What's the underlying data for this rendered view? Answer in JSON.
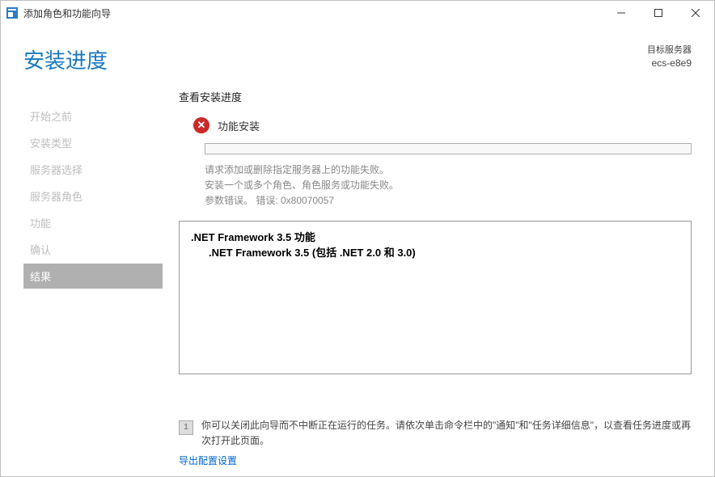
{
  "window": {
    "title": "添加角色和功能向导"
  },
  "header": {
    "title": "安装进度",
    "target_label": "目标服务器",
    "target_name": "ecs-e8e9"
  },
  "sidebar": {
    "steps": [
      {
        "label": "开始之前"
      },
      {
        "label": "安装类型"
      },
      {
        "label": "服务器选择"
      },
      {
        "label": "服务器角色"
      },
      {
        "label": "功能"
      },
      {
        "label": "确认"
      },
      {
        "label": "结果",
        "active": true
      }
    ]
  },
  "main": {
    "section_heading": "查看安装进度",
    "status_label": "功能安装",
    "error_line1": "请求添加或删除指定服务器上的功能失败。",
    "error_line2": "安装一个或多个角色、角色服务或功能失败。",
    "error_line3": "参数错误。 错误: 0x80070057",
    "result_item_parent": ".NET Framework 3.5 功能",
    "result_item_child": ".NET Framework 3.5 (包括 .NET 2.0 和 3.0)",
    "flag_note": "你可以关闭此向导而不中断正在运行的任务。请依次单击命令栏中的\"通知\"和\"任务详细信息\"，以查看任务进度或再次打开此页面。",
    "export_link": "导出配置设置"
  }
}
